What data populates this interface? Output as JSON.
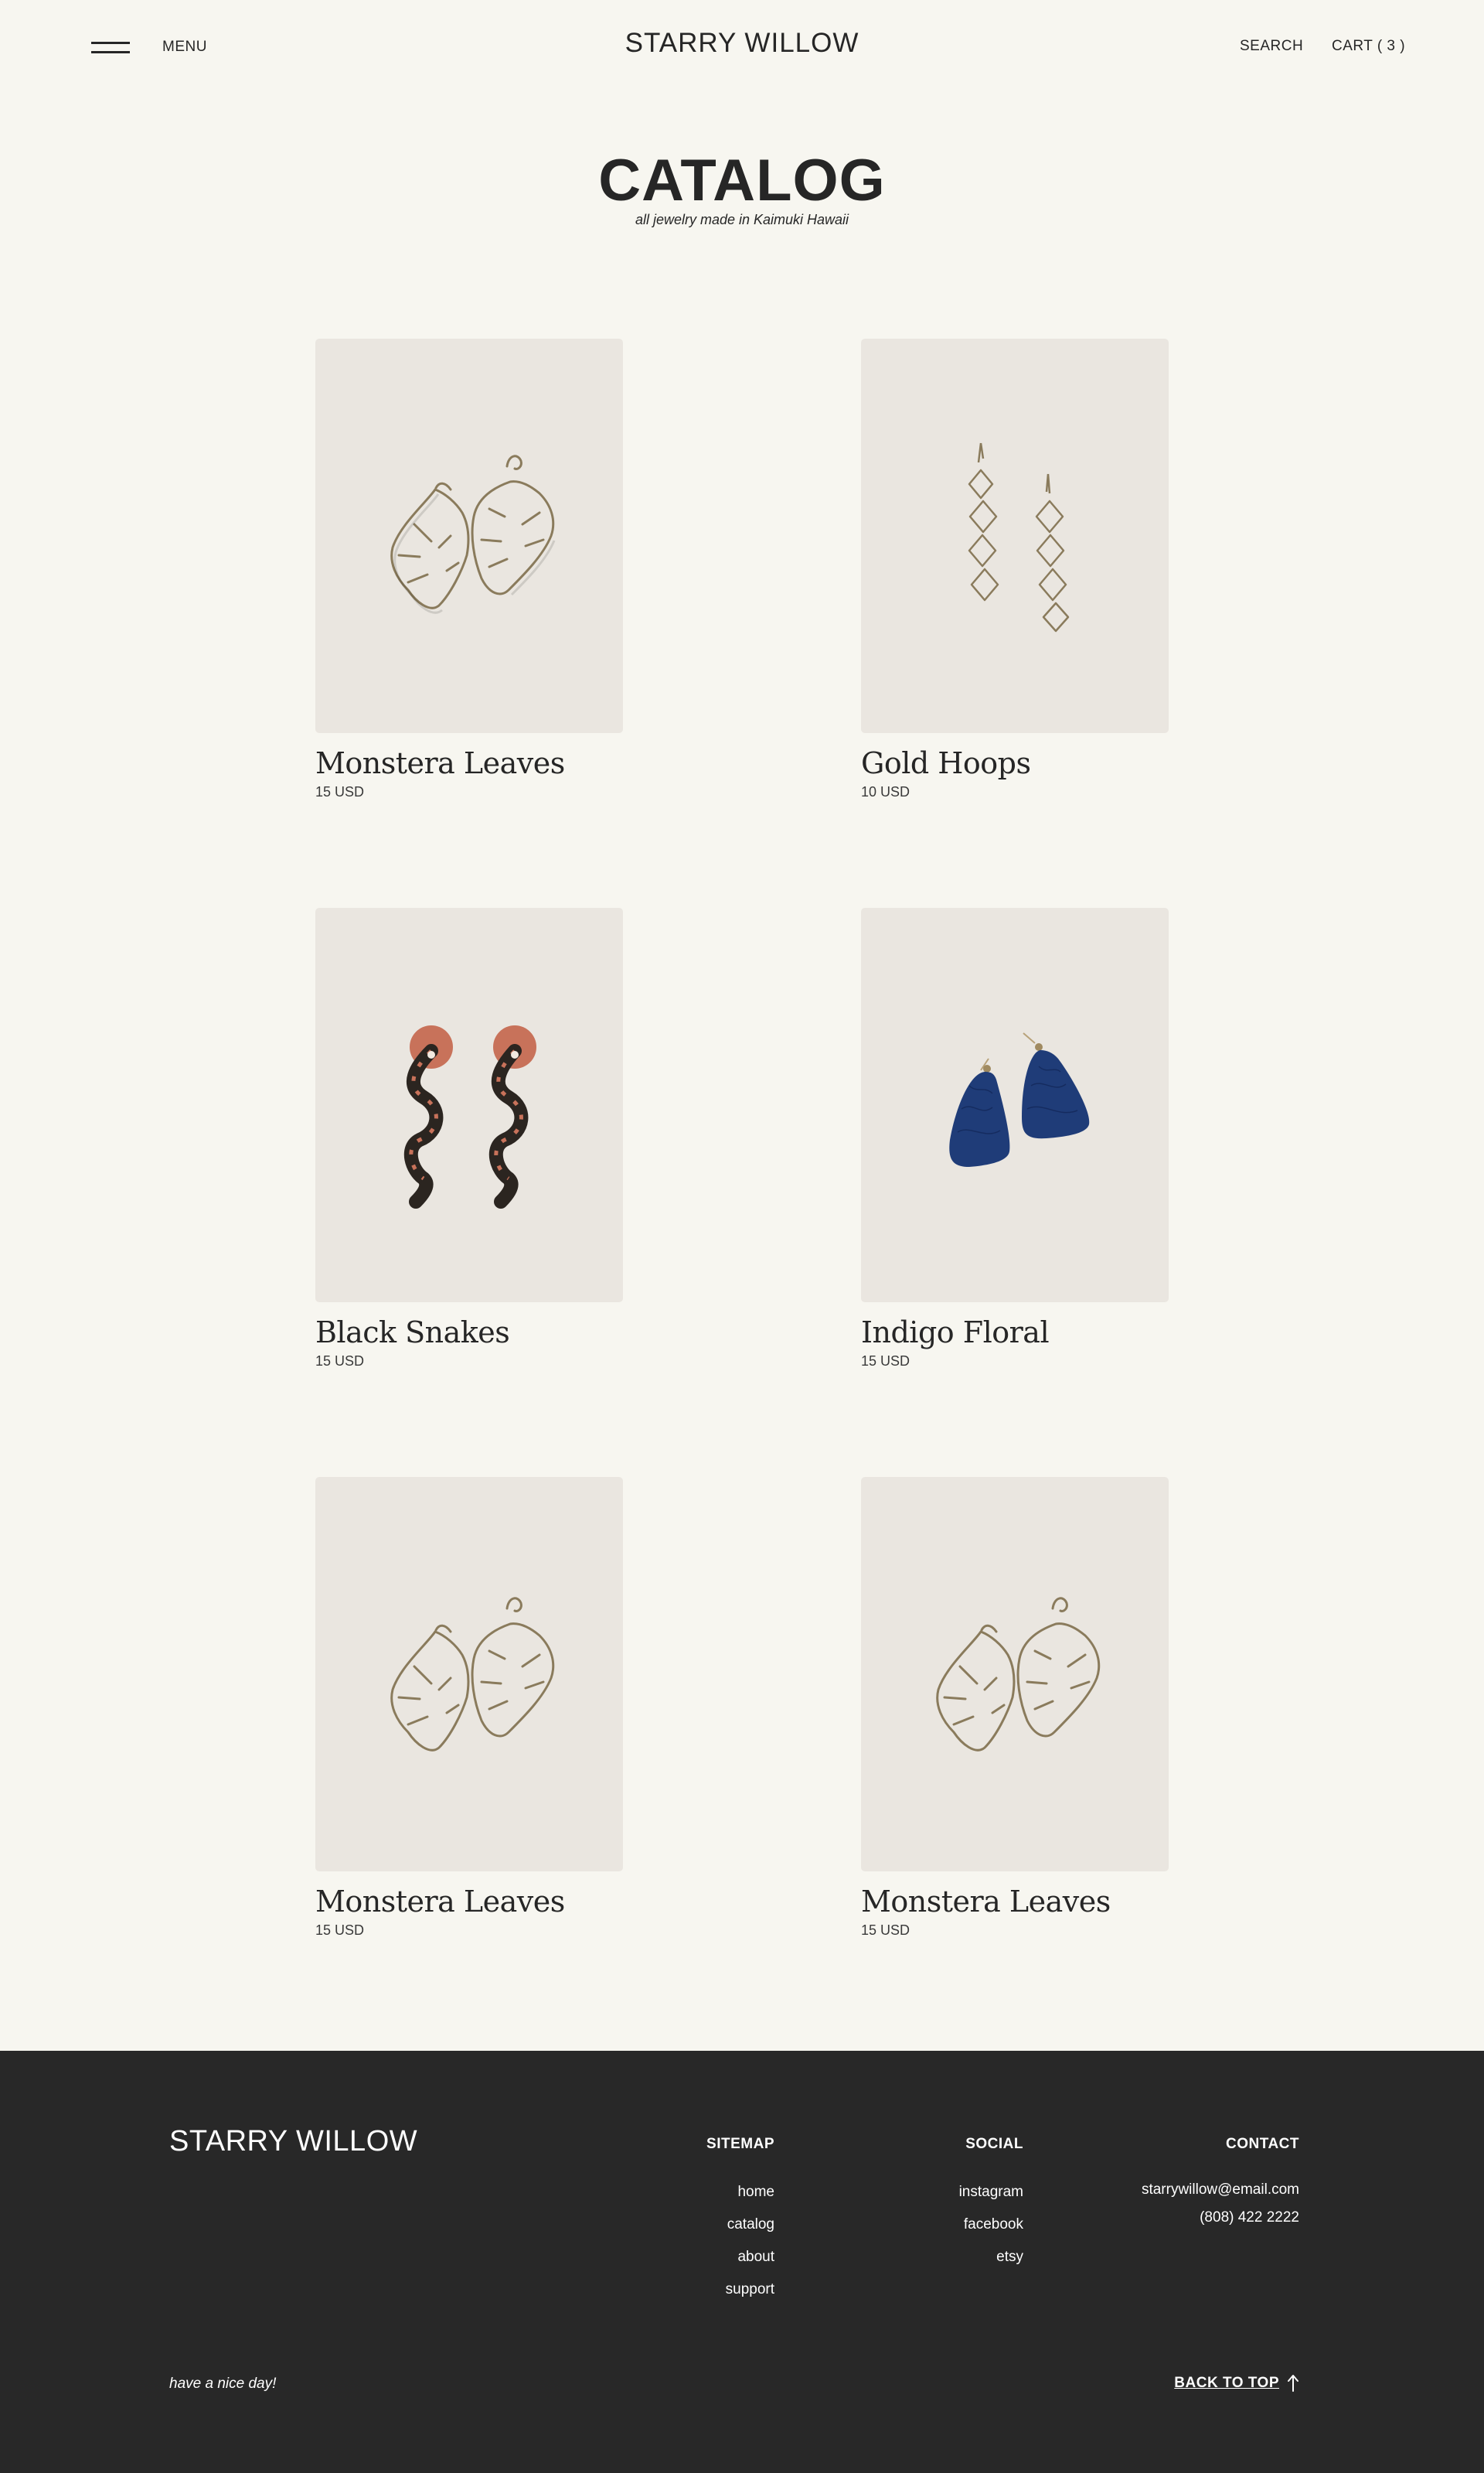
{
  "header": {
    "menu_label": "MENU",
    "brand": "STARRY WILLOW",
    "search_label": "SEARCH",
    "cart_label": "CART ( 3 )"
  },
  "catalog": {
    "title": "CATALOG",
    "subtitle": "all jewelry made in Kaimuki Hawaii"
  },
  "products": [
    {
      "name": "Monstera Leaves",
      "price": "15 USD",
      "image": "monstera-earrings"
    },
    {
      "name": "Gold Hoops",
      "price": "10 USD",
      "image": "gold-hoops-earrings"
    },
    {
      "name": "Black Snakes",
      "price": "15 USD",
      "image": "black-snake-earrings"
    },
    {
      "name": "Indigo Floral",
      "price": "15 USD",
      "image": "indigo-floral-earrings"
    },
    {
      "name": "Monstera Leaves",
      "price": "15 USD",
      "image": "monstera-earrings"
    },
    {
      "name": "Monstera Leaves",
      "price": "15 USD",
      "image": "monstera-earrings"
    }
  ],
  "footer": {
    "brand": "STARRY WILLOW",
    "sitemap": {
      "heading": "SITEMAP",
      "links": [
        "home",
        "catalog",
        "about",
        "support"
      ]
    },
    "social": {
      "heading": "SOCIAL",
      "links": [
        "instagram",
        "facebook",
        "etsy"
      ]
    },
    "contact": {
      "heading": "CONTACT",
      "email": "starrywillow@email.com",
      "phone": "(808) 422 2222"
    },
    "tagline": "have a nice day!",
    "back_to_top": "BACK TO TOP"
  },
  "colors": {
    "page_background": "#f7f6f0",
    "card_background": "#eae6e0",
    "text": "#262626",
    "footer_background": "#282828",
    "footer_text": "#ffffff",
    "indigo": "#1f3c78",
    "terracotta": "#c8725a",
    "wire_gold": "#8a7b5c"
  }
}
